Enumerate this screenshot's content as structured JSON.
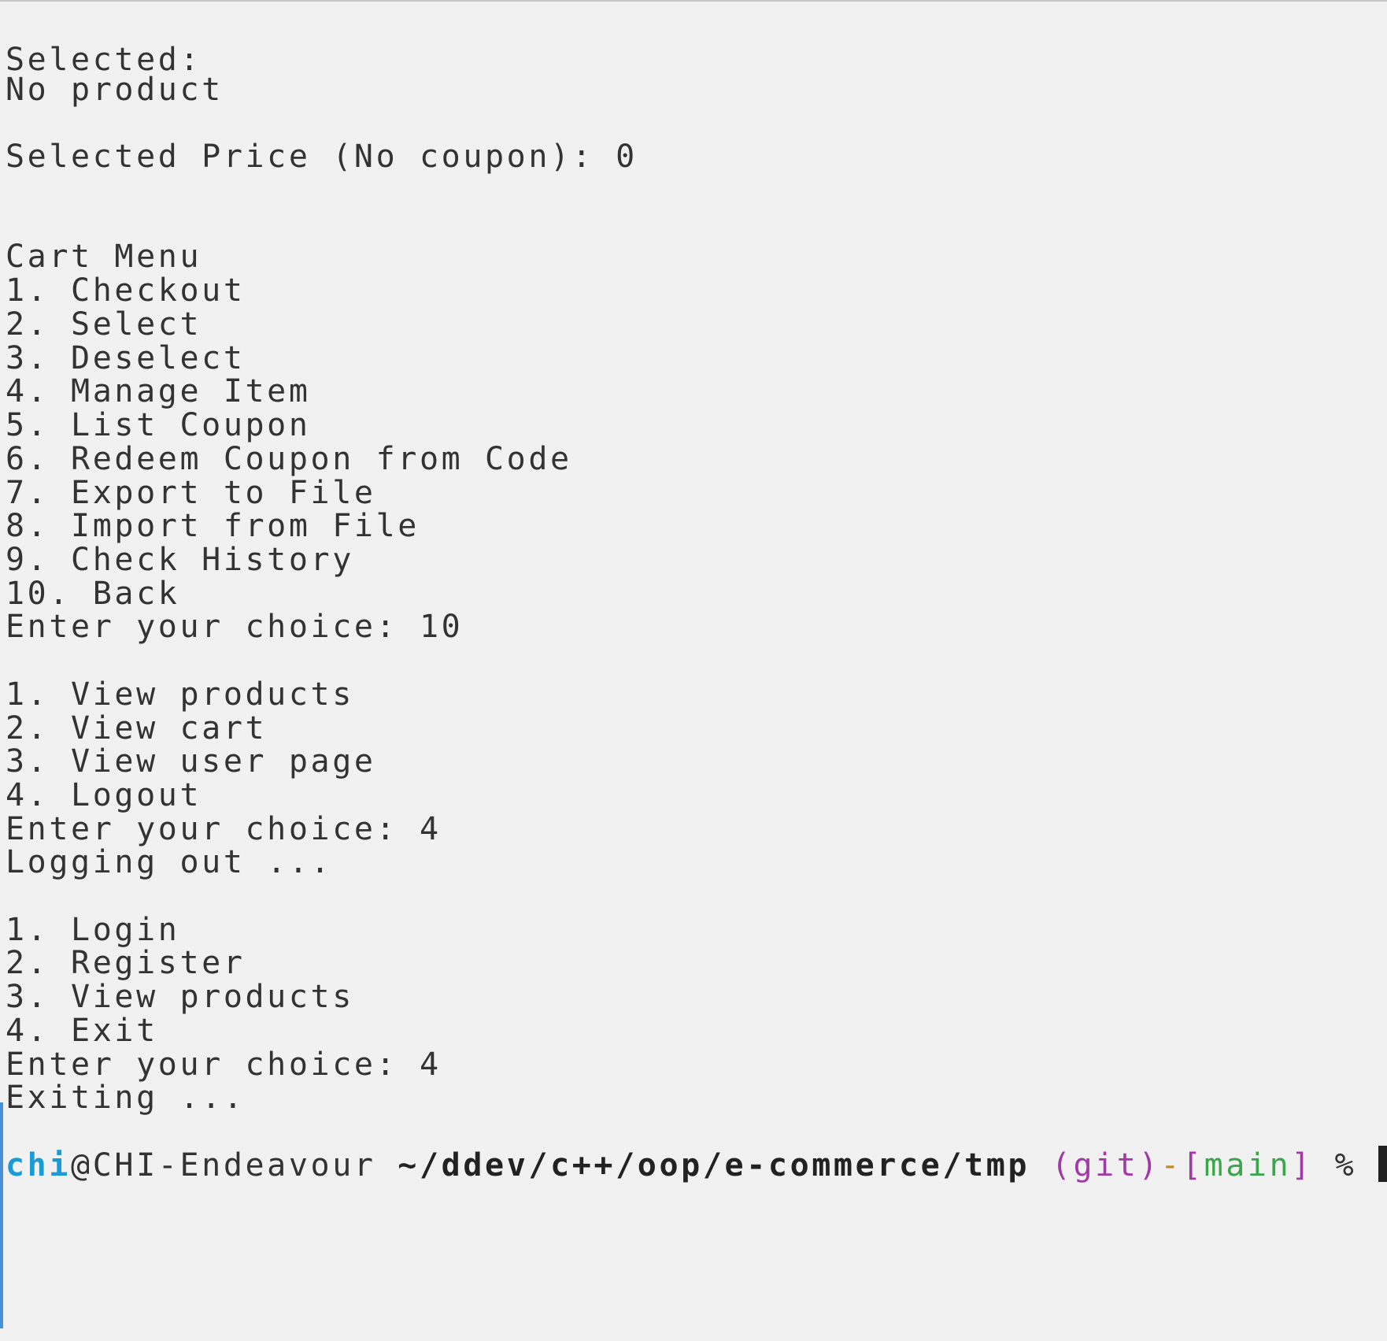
{
  "lines": [
    {
      "text": "Selected:"
    },
    {
      "text": "No product"
    },
    {
      "text": "Selected Price (No coupon): 0"
    },
    {
      "text": "Cart Menu"
    },
    {
      "text": "1. Checkout"
    },
    {
      "text": "2. Select"
    },
    {
      "text": "3. Deselect"
    },
    {
      "text": "4. Manage Item"
    },
    {
      "text": "5. List Coupon"
    },
    {
      "text": "6. Redeem Coupon from Code"
    },
    {
      "text": "7. Export to File"
    },
    {
      "text": "8. Import from File"
    },
    {
      "text": "9. Check History"
    },
    {
      "text": "10. Back"
    },
    {
      "text": "Enter your choice: 10"
    },
    {
      "text": "1. View products"
    },
    {
      "text": "2. View cart"
    },
    {
      "text": "3. View user page"
    },
    {
      "text": "4. Logout"
    },
    {
      "text": "Enter your choice: 4"
    },
    {
      "text": "Logging out ..."
    },
    {
      "text": "1. Login"
    },
    {
      "text": "2. Register"
    },
    {
      "text": "3. View products"
    },
    {
      "text": "4. Exit"
    },
    {
      "text": "Enter your choice: 4"
    },
    {
      "text": "Exiting ..."
    }
  ],
  "prompt": {
    "user": "chi",
    "at_host": "@CHI-Endeavour",
    "path": "~/ddev/c++/oop/e-commerce/tmp",
    "vcs_open": "(git)",
    "dash": "-",
    "branch_open": "[",
    "branch": "main",
    "branch_close": "]",
    "symbol": "%"
  },
  "colors": {
    "background": "#f1f1f1",
    "text": "#333333",
    "user": "#1a9ad6",
    "git": "#a23aa6",
    "branch": "#3aa64a",
    "gutter": "#4a90d9"
  }
}
